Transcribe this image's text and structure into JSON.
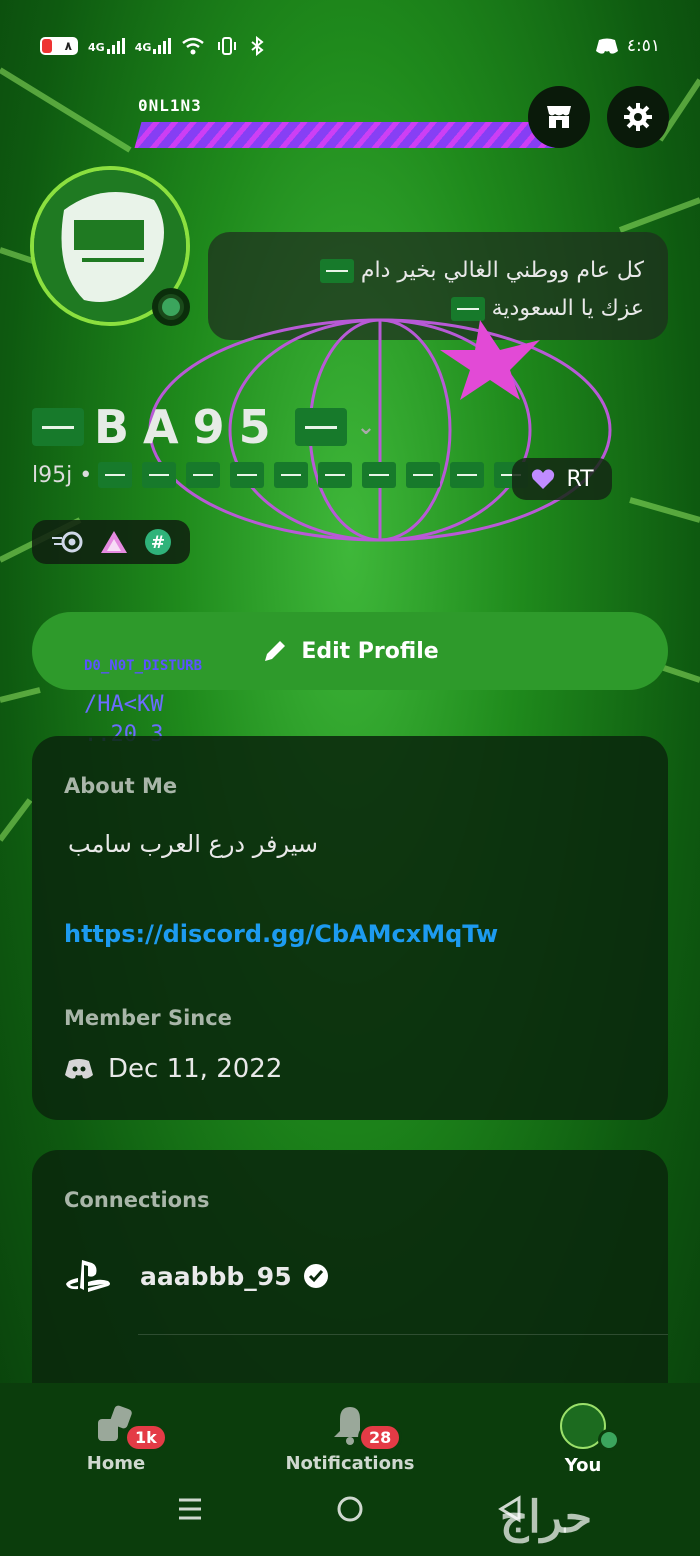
{
  "status_bar": {
    "battery": "٨",
    "network_1": "4G",
    "network_2": "4G",
    "time": "٤:٥١"
  },
  "profile": {
    "online_label": "0NL1N3",
    "status_text_line1": "كل عام ووطني الغالي بخير دام",
    "status_text_line2": "عزك يا السعودية",
    "display_name": "BA95",
    "username": "l95j •",
    "rt_label": "RT",
    "dnd_label": "D0_N0T_DISTURB",
    "hack_line1": "/HA<KW",
    "hack_line2": "..20 3"
  },
  "edit_button": {
    "label": "Edit Profile"
  },
  "about": {
    "title": "About Me",
    "text": "سيرفر درع العرب سامب",
    "link": "https://discord.gg/CbAMcxMqTw",
    "member_since_title": "Member Since",
    "member_since_date": "Dec 11, 2022"
  },
  "connections": {
    "title": "Connections",
    "items": [
      {
        "service": "playstation-icon",
        "name": "aaabbb_95",
        "verified": true
      }
    ]
  },
  "bottom_nav": {
    "tabs": [
      {
        "label": "Home",
        "badge": "1k"
      },
      {
        "label": "Notifications",
        "badge": "28"
      },
      {
        "label": "You"
      }
    ]
  },
  "watermark": "حراج",
  "colors": {
    "accent_green": "#2e9a2b",
    "link_blue": "#1d9bf0",
    "badge_red": "#e43b46",
    "online_green": "#3ba55d"
  }
}
